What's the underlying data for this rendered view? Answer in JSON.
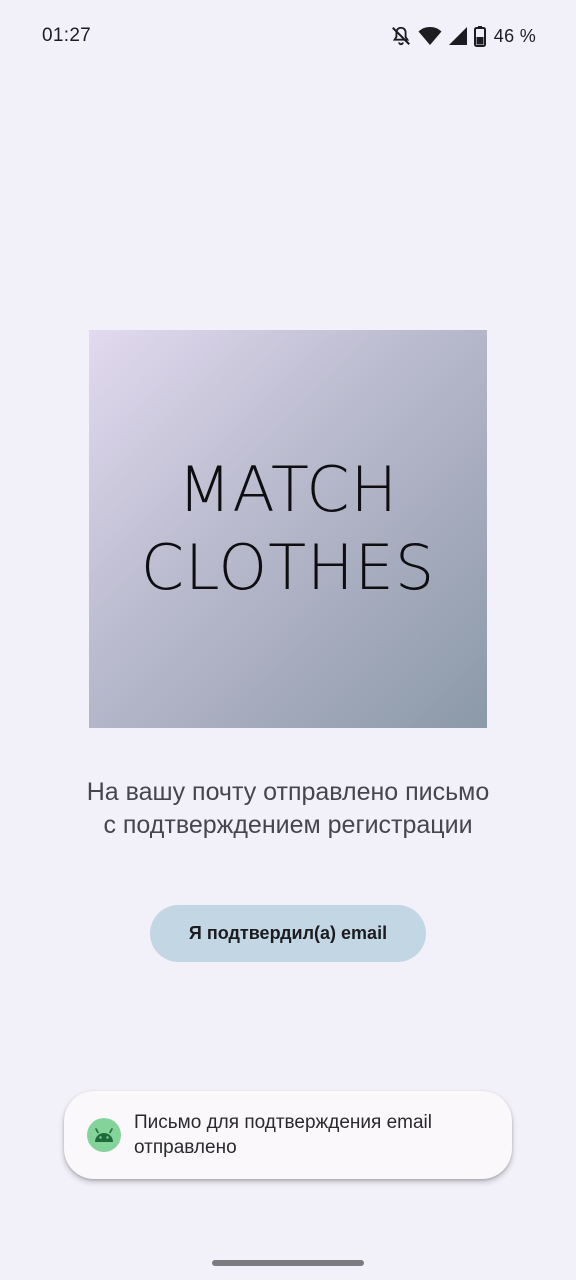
{
  "status_bar": {
    "time": "01:27",
    "battery_percent": "46 %",
    "icons": [
      "mute-icon",
      "wifi-icon",
      "cell-signal-icon",
      "battery-icon"
    ]
  },
  "logo": {
    "line1": "MATCH",
    "line2": "CLOTHES"
  },
  "message": {
    "line1": "На вашу почту отправлено письмо",
    "line2": "с подтверждением регистрации"
  },
  "confirm_button": {
    "label": "Я подтвердил(а) email"
  },
  "toast": {
    "icon": "android-icon",
    "line1": "Письмо для подтверждения email",
    "line2": "отправлено"
  },
  "colors": {
    "background": "#f2f0f9",
    "button": "#c3d6e3",
    "toast_icon": "#84d39a"
  }
}
